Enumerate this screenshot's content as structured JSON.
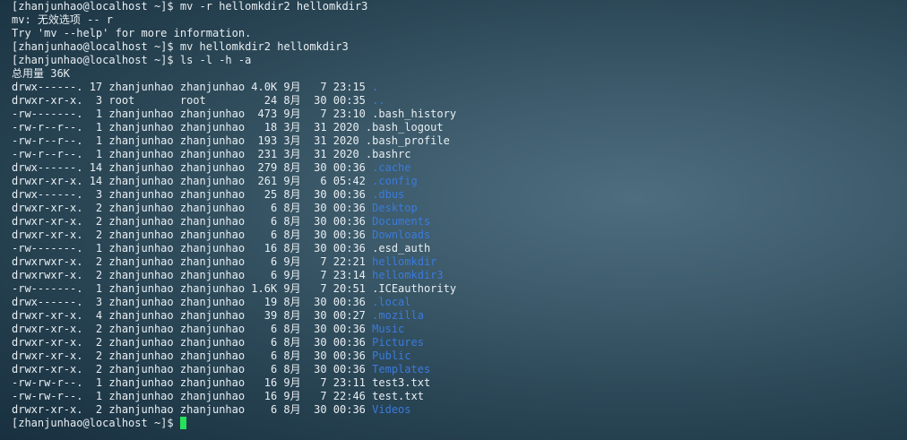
{
  "terminal": {
    "prompt": "[zhanjunhao@localhost ~]$ ",
    "lines": [
      {
        "kind": "prompt",
        "cmd": "mv -r hellomkdir2 hellomkdir3"
      },
      {
        "kind": "output",
        "text": "mv: 无效选项 -- r"
      },
      {
        "kind": "output",
        "text": "Try 'mv --help' for more information."
      },
      {
        "kind": "prompt",
        "cmd": "mv hellomkdir2 hellomkdir3"
      },
      {
        "kind": "prompt",
        "cmd": "ls -l -h -a"
      },
      {
        "kind": "output",
        "text": "总用量 36K"
      },
      {
        "kind": "entry",
        "meta": "drwx------. 17 zhanjunhao zhanjunhao 4.0K 9月   7 23:15 ",
        "name": ".",
        "dir": true
      },
      {
        "kind": "entry",
        "meta": "drwxr-xr-x.  3 root       root         24 8月  30 00:35 ",
        "name": "..",
        "dir": true
      },
      {
        "kind": "entry",
        "meta": "-rw-------.  1 zhanjunhao zhanjunhao  473 9月   7 23:10 ",
        "name": ".bash_history",
        "dir": false
      },
      {
        "kind": "entry",
        "meta": "-rw-r--r--.  1 zhanjunhao zhanjunhao   18 3月  31 2020 ",
        "name": ".bash_logout",
        "dir": false
      },
      {
        "kind": "entry",
        "meta": "-rw-r--r--.  1 zhanjunhao zhanjunhao  193 3月  31 2020 ",
        "name": ".bash_profile",
        "dir": false
      },
      {
        "kind": "entry",
        "meta": "-rw-r--r--.  1 zhanjunhao zhanjunhao  231 3月  31 2020 ",
        "name": ".bashrc",
        "dir": false
      },
      {
        "kind": "entry",
        "meta": "drwx------. 14 zhanjunhao zhanjunhao  279 8月  30 00:36 ",
        "name": ".cache",
        "dir": true
      },
      {
        "kind": "entry",
        "meta": "drwxr-xr-x. 14 zhanjunhao zhanjunhao  261 9月   6 05:42 ",
        "name": ".config",
        "dir": true
      },
      {
        "kind": "entry",
        "meta": "drwx------.  3 zhanjunhao zhanjunhao   25 8月  30 00:36 ",
        "name": ".dbus",
        "dir": true
      },
      {
        "kind": "entry",
        "meta": "drwxr-xr-x.  2 zhanjunhao zhanjunhao    6 8月  30 00:36 ",
        "name": "Desktop",
        "dir": true
      },
      {
        "kind": "entry",
        "meta": "drwxr-xr-x.  2 zhanjunhao zhanjunhao    6 8月  30 00:36 ",
        "name": "Documents",
        "dir": true
      },
      {
        "kind": "entry",
        "meta": "drwxr-xr-x.  2 zhanjunhao zhanjunhao    6 8月  30 00:36 ",
        "name": "Downloads",
        "dir": true
      },
      {
        "kind": "entry",
        "meta": "-rw-------.  1 zhanjunhao zhanjunhao   16 8月  30 00:36 ",
        "name": ".esd_auth",
        "dir": false
      },
      {
        "kind": "entry",
        "meta": "drwxrwxr-x.  2 zhanjunhao zhanjunhao    6 9月   7 22:21 ",
        "name": "hellomkdir",
        "dir": true
      },
      {
        "kind": "entry",
        "meta": "drwxrwxr-x.  2 zhanjunhao zhanjunhao    6 9月   7 23:14 ",
        "name": "hellomkdir3",
        "dir": true
      },
      {
        "kind": "entry",
        "meta": "-rw-------.  1 zhanjunhao zhanjunhao 1.6K 9月   7 20:51 ",
        "name": ".ICEauthority",
        "dir": false
      },
      {
        "kind": "entry",
        "meta": "drwx------.  3 zhanjunhao zhanjunhao   19 8月  30 00:36 ",
        "name": ".local",
        "dir": true
      },
      {
        "kind": "entry",
        "meta": "drwxr-xr-x.  4 zhanjunhao zhanjunhao   39 8月  30 00:27 ",
        "name": ".mozilla",
        "dir": true
      },
      {
        "kind": "entry",
        "meta": "drwxr-xr-x.  2 zhanjunhao zhanjunhao    6 8月  30 00:36 ",
        "name": "Music",
        "dir": true
      },
      {
        "kind": "entry",
        "meta": "drwxr-xr-x.  2 zhanjunhao zhanjunhao    6 8月  30 00:36 ",
        "name": "Pictures",
        "dir": true
      },
      {
        "kind": "entry",
        "meta": "drwxr-xr-x.  2 zhanjunhao zhanjunhao    6 8月  30 00:36 ",
        "name": "Public",
        "dir": true
      },
      {
        "kind": "entry",
        "meta": "drwxr-xr-x.  2 zhanjunhao zhanjunhao    6 8月  30 00:36 ",
        "name": "Templates",
        "dir": true
      },
      {
        "kind": "entry",
        "meta": "-rw-rw-r--.  1 zhanjunhao zhanjunhao   16 9月   7 23:11 ",
        "name": "test3.txt",
        "dir": false
      },
      {
        "kind": "entry",
        "meta": "-rw-rw-r--.  1 zhanjunhao zhanjunhao   16 9月   7 22:46 ",
        "name": "test.txt",
        "dir": false
      },
      {
        "kind": "entry",
        "meta": "drwxr-xr-x.  2 zhanjunhao zhanjunhao    6 8月  30 00:36 ",
        "name": "Videos",
        "dir": true
      },
      {
        "kind": "prompt",
        "cmd": "",
        "cursor": true
      }
    ]
  },
  "colors": {
    "text": "#e8eef2",
    "directory": "#3b7bdc",
    "cursor": "#25e05a"
  }
}
